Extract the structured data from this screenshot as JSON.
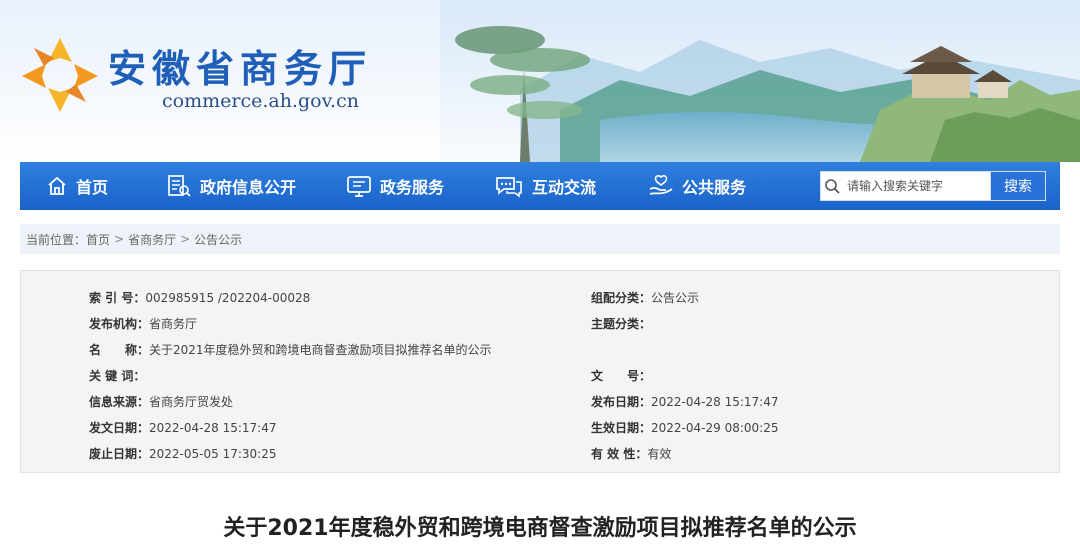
{
  "header": {
    "site_title": "安徽省商务厅",
    "site_domain": "commerce.ah.gov.cn"
  },
  "nav": {
    "items": [
      {
        "label": "首页",
        "icon": "home-icon"
      },
      {
        "label": "政府信息公开",
        "icon": "document-icon"
      },
      {
        "label": "政务服务",
        "icon": "monitor-icon"
      },
      {
        "label": "互动交流",
        "icon": "chat-icon"
      },
      {
        "label": "公共服务",
        "icon": "hands-icon"
      }
    ],
    "search_placeholder": "请输入搜索关键字",
    "search_button": "搜索"
  },
  "breadcrumb": {
    "prefix": "当前位置：",
    "items": [
      "首页",
      "省商务厅",
      "公告公示"
    ],
    "separator": ">"
  },
  "info": {
    "index_label": "索 引 号：",
    "index_value": "002985915 /202204-00028",
    "category_label": "组配分类：",
    "category_value": "公告公示",
    "publisher_label": "发布机构：",
    "publisher_value": "省商务厅",
    "topic_label": "主题分类：",
    "topic_value": "",
    "name_label": "名　　称：",
    "name_value": "关于2021年度稳外贸和跨境电商督查激励项目拟推荐名单的公示",
    "keywords_label": "关 键 词：",
    "keywords_value": "",
    "docno_label": "文　　号：",
    "docno_value": "",
    "source_label": "信息来源：",
    "source_value": "省商务厅贸发处",
    "pubdate_label": "发布日期：",
    "pubdate_value": "2022-04-28 15:17:47",
    "issuedate_label": "发文日期：",
    "issuedate_value": "2022-04-28 15:17:47",
    "effective_label": "生效日期：",
    "effective_value": "2022-04-29 08:00:25",
    "expire_label": "废止日期：",
    "expire_value": "2022-05-05 17:30:25",
    "validity_label": "有 效 性：",
    "validity_value": "有效"
  },
  "article": {
    "title": "关于2021年度稳外贸和跨境电商督查激励项目拟推荐名单的公示"
  },
  "colors": {
    "nav_blue": "#1a63c9",
    "title_blue": "#1f5fb8",
    "logo_orange": "#f39a1e"
  }
}
